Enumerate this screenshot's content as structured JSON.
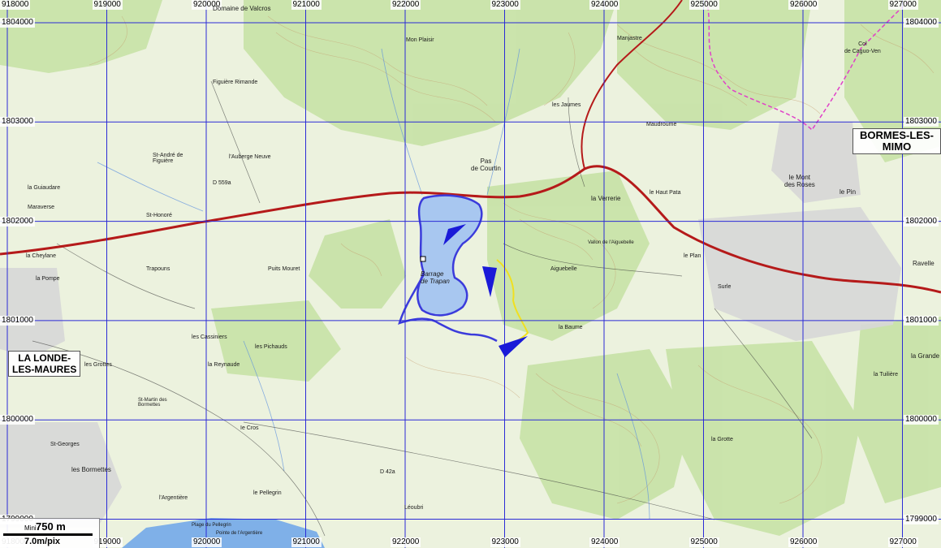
{
  "grid": {
    "x_labels": [
      "918000",
      "919000",
      "920000",
      "921000",
      "922000",
      "923000",
      "924000",
      "925000",
      "926000",
      "927000"
    ],
    "y_labels": [
      "1804000",
      "1803000",
      "1802000",
      "1801000",
      "1800000",
      "1799000"
    ]
  },
  "scale": {
    "mini_label": "Mini",
    "distance": "750 m",
    "resolution": "7.0m/pix"
  },
  "towns": {
    "bormes": "BORMES-LES-MIMO",
    "lalonde_1": "LA LONDE-",
    "lalonde_2": "LES-MAURES"
  },
  "lake": {
    "label_1": "Barrage",
    "label_2": "de Trapan"
  },
  "places": {
    "valcros": "Domaine de Valcros",
    "mont_plaisir": "Mon Plaisir",
    "manjastre": "Manjastre",
    "pas_de_courtin_1": "Pas",
    "pas_de_courtin_2": "de Courtin",
    "la_verrerie": "la Verrerie",
    "le_haut_pata": "le Haut Pata",
    "le_mont_des_roses_1": "le Mont",
    "le_mont_des_roses_2": "des Roses",
    "le_pin": "le Pin",
    "col_de_caguo_ven_1": "Col",
    "col_de_caguo_ven_2": "de Caguo-Ven",
    "st_honore": "St-Honoré",
    "maraverse": "Maraverse",
    "la_chevlane": "la Cheylane",
    "la_pompe": "la Pompe",
    "trapouns": "Trapouns",
    "puits_mouret": "Puits Mouret",
    "figuiere": "Figuière Rimande",
    "laubergue": "l'Auberge Neuve",
    "st_andre": "St-André de Figuière",
    "la_guarrigue": "la Guiaudare",
    "aiguebelle": "Aiguebelle",
    "le_pilon": "le Plan",
    "surle": "Surle",
    "ravelle": "Ravelle",
    "la_grande": "la Grande",
    "la_tuiliere": "la Tuilière",
    "la_grotte": "la Grotte",
    "les_bormettes": "les Bormettes",
    "st_georges": "St-Georges",
    "l_argentiere": "l'Argentière",
    "plage": "Plage du Pellegrin",
    "pointe": "Pointe de l'Argentière",
    "leoubri": "Léoubri",
    "les_pellegrin": "le Pellegrin",
    "les_cassiniers": "les Cassiniers",
    "les_pichauds": "les Pichauds",
    "la_reynaude": "la Reynaude",
    "maravenne_d": "D 559a",
    "d42": "D 42a",
    "le_cros": "Ie Cros",
    "les_grottes": "les Grottes",
    "st_martin": "St-Martin des Bormettes",
    "la_verrerie_r": "Vallon de l'Aiguebelle",
    "maudroume": "Maudroume",
    "la_baume": "la Baume",
    "les_jaumes": "les Jaumes"
  },
  "colors": {
    "grid": "#2b2bd6",
    "road_main": "#b51a1a",
    "trail_blue": "#3b3bdb",
    "trail_yellow": "#f0e020",
    "lake": "#a8c7f0",
    "forest": "#c5dfa6",
    "urban": "#d9d9d9",
    "sea": "#7fb0e8",
    "boundary": "#e040c8"
  },
  "markers": [
    {
      "name": "marker-north",
      "direction": "south-west"
    },
    {
      "name": "marker-middle",
      "direction": "south"
    },
    {
      "name": "marker-south",
      "direction": "west"
    }
  ]
}
